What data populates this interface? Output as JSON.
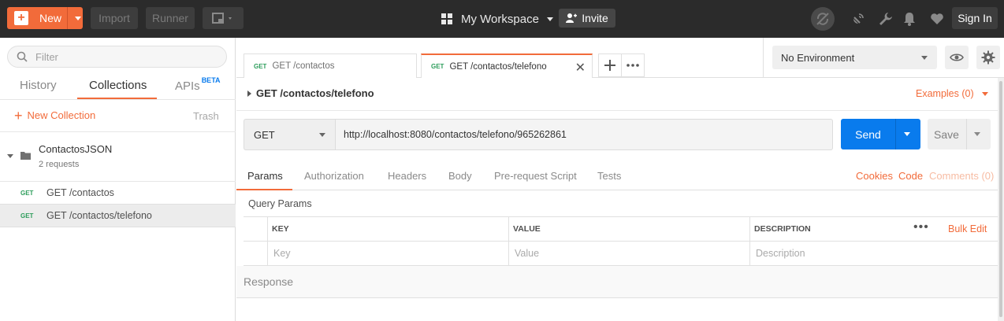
{
  "topbar": {
    "new_label": "New",
    "import_label": "Import",
    "runner_label": "Runner",
    "workspace_label": "My Workspace",
    "invite_label": "Invite",
    "signin_label": "Sign In"
  },
  "sidebar": {
    "search_placeholder": "Filter",
    "tabs": {
      "history": "History",
      "collections": "Collections",
      "apis": "APIs",
      "apis_badge": "BETA"
    },
    "new_collection_label": "New Collection",
    "trash_label": "Trash",
    "collection": {
      "name": "ContactosJSON",
      "count": "2 requests"
    },
    "requests": [
      {
        "method": "GET",
        "name": "GET /contactos"
      },
      {
        "method": "GET",
        "name": "GET /contactos/telefono"
      }
    ]
  },
  "tabs": [
    {
      "method": "GET",
      "name": "GET /contactos"
    },
    {
      "method": "GET",
      "name": "GET /contactos/telefono"
    }
  ],
  "environment": {
    "selected": "No Environment"
  },
  "request": {
    "title": "GET /contactos/telefono",
    "examples_label": "Examples (0)",
    "method": "GET",
    "url": "http://localhost:8080/contactos/telefono/965262861",
    "send_label": "Send",
    "save_label": "Save"
  },
  "request_tabs": {
    "params": "Params",
    "authorization": "Authorization",
    "headers": "Headers",
    "body": "Body",
    "prerequest": "Pre-request Script",
    "tests": "Tests",
    "cookies": "Cookies",
    "code": "Code",
    "comments": "Comments (0)"
  },
  "params": {
    "section_label": "Query Params",
    "headers": {
      "key": "KEY",
      "value": "VALUE",
      "description": "DESCRIPTION"
    },
    "bulk_edit_label": "Bulk Edit",
    "placeholders": {
      "key": "Key",
      "value": "Value",
      "description": "Description"
    }
  },
  "response": {
    "label": "Response"
  },
  "colors": {
    "accent": "#f26b3a",
    "primary": "#097bed",
    "get_method": "#2d9d5b",
    "topbar": "#2b2b2b"
  }
}
